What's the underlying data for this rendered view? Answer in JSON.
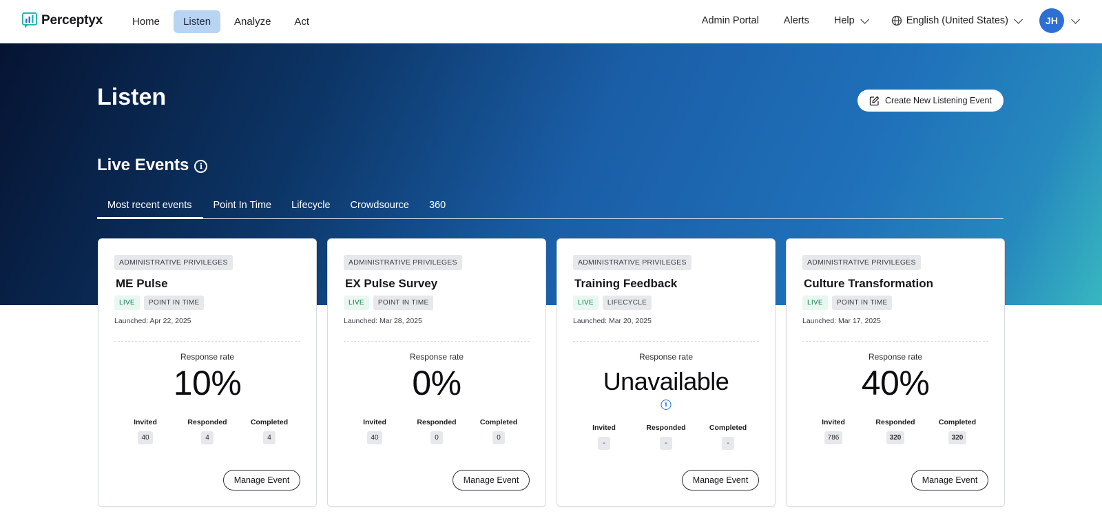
{
  "app": {
    "logo_text": "Perceptyx"
  },
  "nav": {
    "items": [
      {
        "label": "Home",
        "active": false
      },
      {
        "label": "Listen",
        "active": true
      },
      {
        "label": "Analyze",
        "active": false
      },
      {
        "label": "Act",
        "active": false
      }
    ],
    "admin_portal": "Admin Portal",
    "alerts": "Alerts",
    "help": "Help",
    "language": "English (United States)",
    "avatar_initials": "JH"
  },
  "page": {
    "title": "Listen",
    "create_button": "Create New Listening Event",
    "section_title": "Live Events",
    "tabs": [
      "Most recent events",
      "Point In Time",
      "Lifecycle",
      "Crowdsource",
      "360"
    ],
    "active_tab": 0
  },
  "cards": [
    {
      "badge": "ADMINISTRATIVE PRIVILEGES",
      "title": "ME Pulse",
      "status": "LIVE",
      "type": "POINT IN TIME",
      "launched": "Launched: Apr 22, 2025",
      "rate_label": "Response rate",
      "rate": "10%",
      "invited_label": "Invited",
      "invited": "40",
      "responded_label": "Responded",
      "responded": "4",
      "completed_label": "Completed",
      "completed": "4",
      "manage": "Manage Event"
    },
    {
      "badge": "ADMINISTRATIVE PRIVILEGES",
      "title": "EX Pulse Survey",
      "status": "LIVE",
      "type": "POINT IN TIME",
      "launched": "Launched: Mar 28, 2025",
      "rate_label": "Response rate",
      "rate": "0%",
      "invited_label": "Invited",
      "invited": "40",
      "responded_label": "Responded",
      "responded": "0",
      "completed_label": "Completed",
      "completed": "0",
      "manage": "Manage Event"
    },
    {
      "badge": "ADMINISTRATIVE PRIVILEGES",
      "title": "Training Feedback",
      "status": "LIVE",
      "type": "LIFECYCLE",
      "launched": "Launched: Mar 20, 2025",
      "rate_label": "Response rate",
      "rate": "Unavailable",
      "invited_label": "Invited",
      "invited": "-",
      "responded_label": "Responded",
      "responded": "-",
      "completed_label": "Completed",
      "completed": "-",
      "manage": "Manage Event"
    },
    {
      "badge": "ADMINISTRATIVE PRIVILEGES",
      "title": "Culture Transformation",
      "status": "LIVE",
      "type": "POINT IN TIME",
      "launched": "Launched: Mar 17, 2025",
      "rate_label": "Response rate",
      "rate": "40%",
      "invited_label": "Invited",
      "invited": "786",
      "responded_label": "Responded",
      "responded": "320",
      "completed_label": "Completed",
      "completed": "320",
      "manage": "Manage Event"
    }
  ],
  "colors": {
    "accent": "#2e6fd6",
    "nav_active_bg": "#b9d3f3",
    "hero_dark": "#061432",
    "hero_mid": "#1a5ea7",
    "hero_teal": "#38b7c0",
    "live_text": "#0f7a4c"
  },
  "icons": {
    "logo": "chat-bars-icon",
    "language": "globe-icon",
    "create": "edit-square-icon",
    "info": "info-icon"
  }
}
